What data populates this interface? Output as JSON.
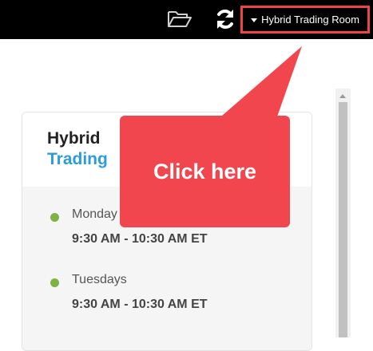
{
  "topbar": {
    "room_selector": "Hybrid Trading Room"
  },
  "card": {
    "title_line1": "Hybrid",
    "title_line2": "Trading",
    "schedule": [
      {
        "day": "Monday",
        "time": "9:30 AM - 10:30 AM ET"
      },
      {
        "day": "Tuesdays",
        "time": "9:30 AM - 10:30 AM ET"
      }
    ]
  },
  "callout": {
    "text": "Click here"
  },
  "colors": {
    "topbar_bg": "#000000",
    "highlight_border": "#ef4444",
    "callout_bg": "#f2464f",
    "title_accent": "#2d9cdb",
    "status_dot": "#7cb342"
  }
}
